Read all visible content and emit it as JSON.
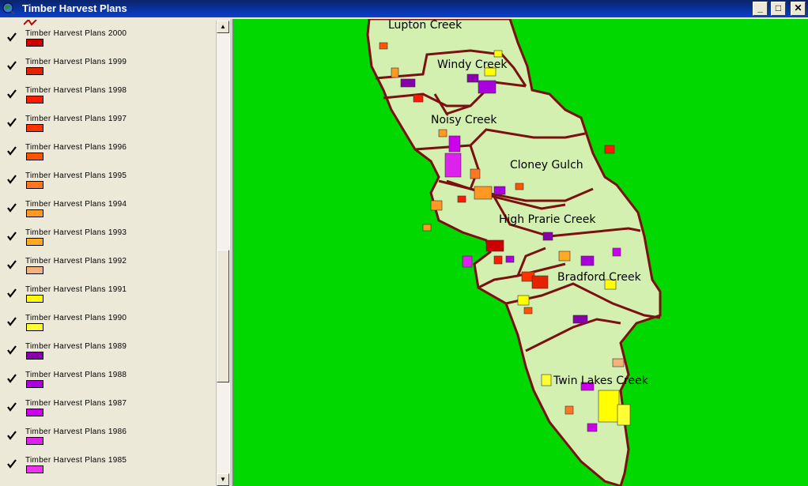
{
  "window": {
    "title": "Timber Harvest Plans",
    "minimize_glyph": "_",
    "maximize_glyph": "□",
    "close_glyph": "✕"
  },
  "legend": {
    "items": [
      {
        "label": "Timber Harvest Plans 2000",
        "color": "#cc0000",
        "checked": true
      },
      {
        "label": "Timber Harvest Plans 1999",
        "color": "#e52200",
        "checked": true
      },
      {
        "label": "Timber Harvest Plans 1998",
        "color": "#ff1a00",
        "checked": true
      },
      {
        "label": "Timber Harvest Plans 1997",
        "color": "#ff3300",
        "checked": true
      },
      {
        "label": "Timber Harvest Plans 1996",
        "color": "#ff5500",
        "checked": true
      },
      {
        "label": "Timber Harvest Plans 1995",
        "color": "#ff7722",
        "checked": true
      },
      {
        "label": "Timber Harvest Plans 1994",
        "color": "#ff9922",
        "checked": true
      },
      {
        "label": "Timber Harvest Plans 1993",
        "color": "#ffaa22",
        "checked": true
      },
      {
        "label": "Timber Harvest Plans 1992",
        "color": "#f2b27a",
        "checked": true
      },
      {
        "label": "Timber Harvest Plans 1991",
        "color": "#ffff00",
        "checked": true
      },
      {
        "label": "Timber Harvest Plans 1990",
        "color": "#ffff33",
        "checked": true
      },
      {
        "label": "Timber Harvest Plans 1989",
        "color": "#8800aa",
        "checked": true
      },
      {
        "label": "Timber Harvest Plans 1988",
        "color": "#aa00dd",
        "checked": true
      },
      {
        "label": "Timber Harvest Plans 1987",
        "color": "#cc00ee",
        "checked": true
      },
      {
        "label": "Timber Harvest Plans 1986",
        "color": "#dd22ee",
        "checked": true
      },
      {
        "label": "Timber Harvest Plans 1985",
        "color": "#ee33ee",
        "checked": true
      }
    ]
  },
  "map": {
    "background_color": "#00d800",
    "terrain_color": "#d4f0b0",
    "boundary_color": "#7a1010",
    "watersheds": [
      "Lupton Creek",
      "Windy Creek",
      "Noisy Creek",
      "Cloney Gulch",
      "High Prarie Creek",
      "Bradford Creek",
      "Twin Lakes Creek"
    ]
  }
}
